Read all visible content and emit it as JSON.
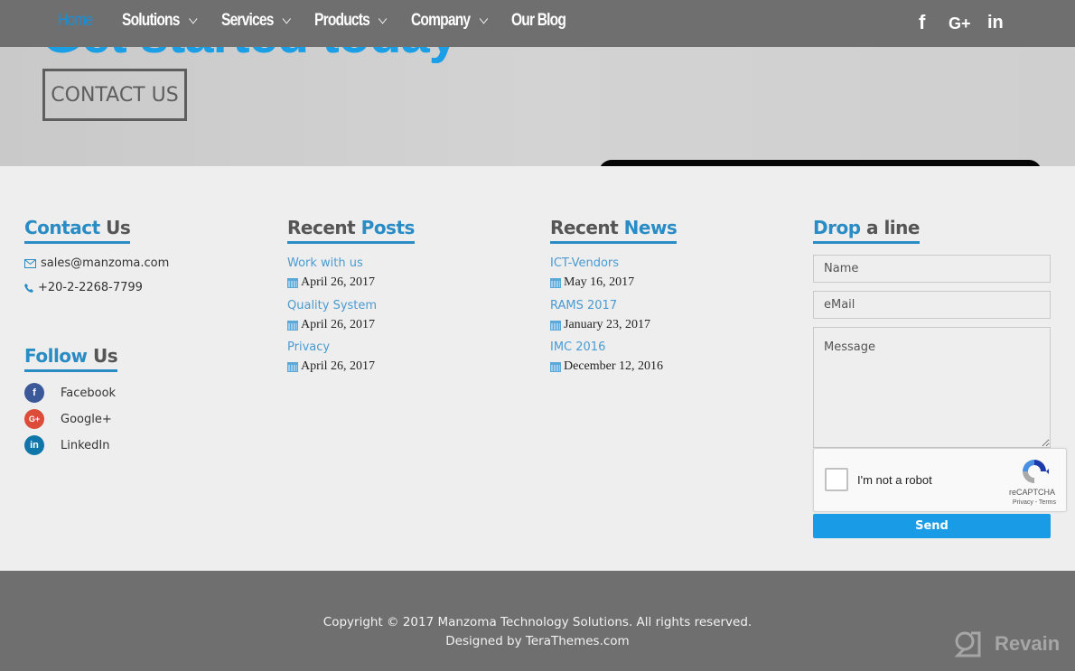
{
  "nav": {
    "items": [
      {
        "label": "Home",
        "active": true,
        "dropdown": false
      },
      {
        "label": "Solutions",
        "active": false,
        "dropdown": true
      },
      {
        "label": "Services",
        "active": false,
        "dropdown": true
      },
      {
        "label": "Products",
        "active": false,
        "dropdown": true
      },
      {
        "label": "Company",
        "active": false,
        "dropdown": true
      },
      {
        "label": "Our Blog",
        "active": false,
        "dropdown": false
      }
    ],
    "social": [
      {
        "icon": "facebook-icon",
        "glyph": "f"
      },
      {
        "icon": "google-plus-icon",
        "glyph": "G+"
      },
      {
        "icon": "linkedin-icon",
        "glyph": "in"
      }
    ]
  },
  "hero": {
    "heading": "Get started today",
    "cta_label": "CONTACT US"
  },
  "contact": {
    "title_accent": "Contact",
    "title_rest": " Us",
    "email_icon": "envelope-icon",
    "email": "sales@manzoma.com",
    "phone_icon": "phone-icon",
    "phone": "+20-2-2268-7799"
  },
  "follow": {
    "title_accent": "Follow",
    "title_rest": " Us",
    "items": [
      {
        "label": "Facebook",
        "icon": "facebook-icon",
        "glyph": "f",
        "color": "#3b5998"
      },
      {
        "label": "Google+",
        "icon": "google-plus-icon",
        "glyph": "G+",
        "color": "#dd4b39"
      },
      {
        "label": "LinkedIn",
        "icon": "linkedin-icon",
        "glyph": "in",
        "color": "#0e76a8"
      }
    ]
  },
  "recent_posts": {
    "title_rest": "Recent ",
    "title_accent": "Posts",
    "items": [
      {
        "title": "Work with us",
        "date": "April 26, 2017"
      },
      {
        "title": "Quality System",
        "date": "April 26, 2017"
      },
      {
        "title": "Privacy",
        "date": "April 26, 2017"
      }
    ]
  },
  "recent_news": {
    "title_rest": "Recent ",
    "title_accent": "News",
    "items": [
      {
        "title": "ICT-Vendors",
        "date": "May 16, 2017"
      },
      {
        "title": "RAMS 2017",
        "date": "January 23, 2017"
      },
      {
        "title": "IMC 2016",
        "date": "December 12, 2016"
      }
    ]
  },
  "form": {
    "title_accent": "Drop",
    "title_rest": " a line",
    "name_placeholder": "Name",
    "email_placeholder": "eMail",
    "message_placeholder": "Message",
    "captcha_label": "I'm not a robot",
    "captcha_brand": "reCAPTCHA",
    "captcha_terms": "Privacy - Terms",
    "send_label": "Send"
  },
  "footer": {
    "copyright": "Copyright © 2017 Manzoma Technology Solutions. All rights reserved.",
    "designed_by": "Designed by TeraThemes.com",
    "watermark": "Revain"
  },
  "colors": {
    "accent": "#2a8cc4",
    "button": "#1a9be6",
    "nav_bg": "#6f6f6f"
  }
}
